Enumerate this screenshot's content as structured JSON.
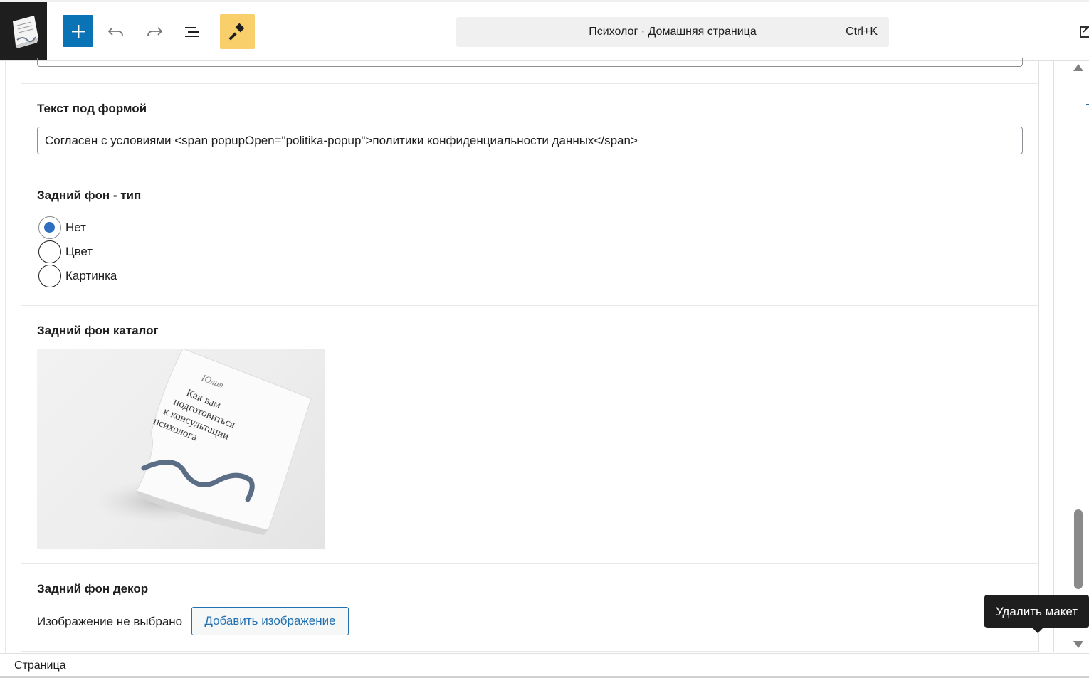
{
  "toolbar": {
    "add_icon": "plus-icon",
    "undo_icon": "undo-icon",
    "redo_icon": "redo-icon",
    "list_view_icon": "list-view-icon",
    "tools_icon": "brush-icon",
    "tools_active_color": "#f8cf6a",
    "add_color": "#0a73b6"
  },
  "command_bar": {
    "title": "Психолог · Домашняя страница",
    "shortcut": "Ctrl+K"
  },
  "fields": {
    "text_under_form": {
      "label": "Текст под формой",
      "value": "Согласен с условиями <span popupOpen=\"politika-popup\">политики конфиденциальности данных</span>"
    },
    "background_type": {
      "label": "Задний фон - тип",
      "options": [
        "Нет",
        "Цвет",
        "Картинка"
      ],
      "selected": "Нет"
    },
    "background_catalog": {
      "label": "Задний фон каталог",
      "image_text": [
        "Как вам",
        "подготовиться",
        "к консультации",
        "психолога"
      ]
    },
    "background_decor": {
      "label": "Задний фон декор",
      "no_image_text": "Изображение не выбрано",
      "add_button": "Добавить изображение"
    }
  },
  "tooltip": {
    "text": "Удалить макет"
  },
  "footer": {
    "breadcrumb": "Страница"
  }
}
